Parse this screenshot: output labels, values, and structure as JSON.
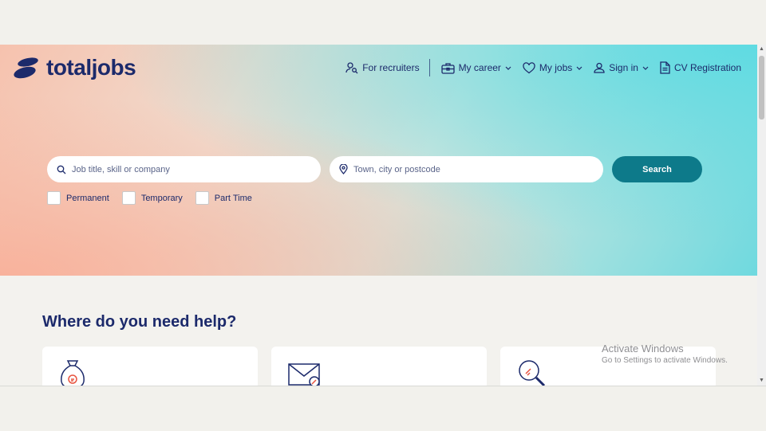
{
  "brand": {
    "name": "totaljobs",
    "color": "#1c2a6b"
  },
  "nav": {
    "recruiters": "For recruiters",
    "career": "My career",
    "jobs": "My jobs",
    "signin": "Sign in",
    "cv": "CV Registration"
  },
  "search": {
    "keyword_placeholder": "Job title, skill or company",
    "location_placeholder": "Town, city or postcode",
    "button_label": "Search",
    "button_color": "#0d7a8a"
  },
  "filters": [
    "Permanent",
    "Temporary",
    "Part Time"
  ],
  "help": {
    "title": "Where do you need help?",
    "cards": [
      {
        "icon": "money-bag-icon"
      },
      {
        "icon": "envelope-icon"
      },
      {
        "icon": "magnifier-icon"
      }
    ]
  },
  "watermark": {
    "title": "Activate Windows",
    "subtitle": "Go to Settings to activate Windows."
  }
}
